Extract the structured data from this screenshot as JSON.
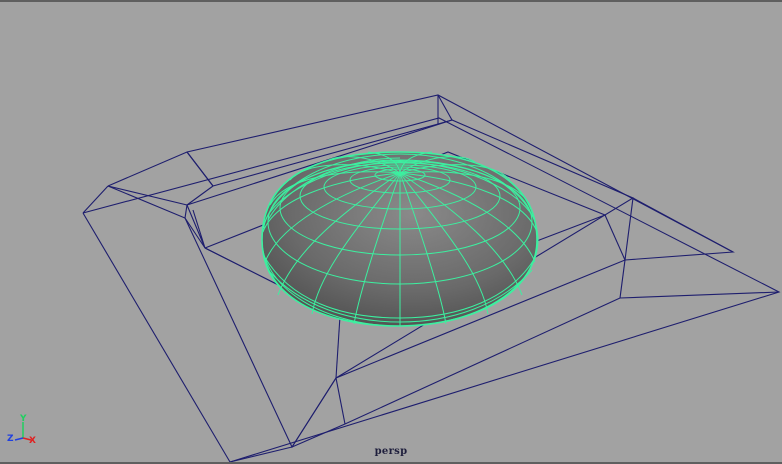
{
  "viewport": {
    "camera_name": "persp",
    "background_color": "#a2a2a2",
    "wireframe_color": "#1e1e6e",
    "selected_wireframe_color": "#3cf0a0"
  },
  "axis_gizmo": {
    "x_label": "X",
    "y_label": "Y",
    "z_label": "Z",
    "x_color": "#e02020",
    "y_color": "#20d060",
    "z_color": "#2040e0"
  },
  "scene": {
    "objects": [
      {
        "name": "outer-tray",
        "selected": false
      },
      {
        "name": "hemisphere",
        "selected": true
      }
    ]
  }
}
